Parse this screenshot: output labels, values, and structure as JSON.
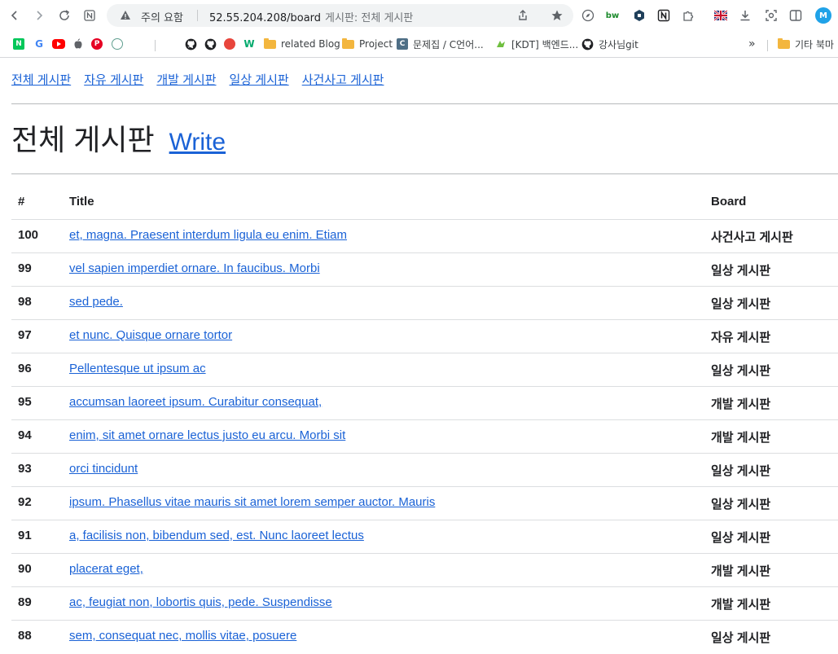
{
  "browser": {
    "security_text": "주의 요함",
    "url": "52.55.204.208/board",
    "page_title": "게시판: 전체 게시판",
    "profile_initial": "M",
    "nav_icons": [
      "back-icon",
      "forward-icon",
      "reload-icon",
      "notion-page-icon"
    ],
    "extensions": [
      "compass-icon",
      "bw-extension-icon",
      "hex-extension-icon",
      "notion-icon",
      "puzzle-icon",
      "uk-flag-icon",
      "download-icon",
      "screenshot-icon",
      "sidepanel-icon"
    ],
    "extension_labels": {
      "bw": "bw"
    }
  },
  "bookmarks": [
    {
      "label": "related Blog",
      "type": "folder"
    },
    {
      "label": "Project",
      "type": "folder"
    },
    {
      "label": "문제집 / C언어...",
      "type": "site"
    },
    {
      "label": "[KDT] 백엔드...",
      "type": "site"
    },
    {
      "label": "강사님git",
      "type": "github"
    },
    {
      "label": "기타 북마",
      "type": "folder"
    }
  ],
  "bookmarks_overflow": "»",
  "nav": {
    "links": [
      "전체 게시판",
      "자유 게시판",
      "개발 게시판",
      "일상 게시판",
      "사건사고 게시판"
    ]
  },
  "heading": {
    "title": "전체 게시판",
    "write_link": "Write"
  },
  "table": {
    "headers": {
      "num": "#",
      "title": "Title",
      "board": "Board"
    },
    "rows": [
      {
        "num": "100",
        "title": "et, magna. Praesent interdum ligula eu enim. Etiam",
        "board": "사건사고 게시판"
      },
      {
        "num": "99",
        "title": "vel sapien imperdiet ornare. In faucibus. Morbi",
        "board": "일상 게시판"
      },
      {
        "num": "98",
        "title": "sed pede.",
        "board": "일상 게시판"
      },
      {
        "num": "97",
        "title": "et nunc. Quisque ornare tortor",
        "board": "자유 게시판"
      },
      {
        "num": "96",
        "title": "Pellentesque ut ipsum ac",
        "board": "일상 게시판"
      },
      {
        "num": "95",
        "title": "accumsan laoreet ipsum. Curabitur consequat,",
        "board": "개발 게시판"
      },
      {
        "num": "94",
        "title": "enim, sit amet ornare lectus justo eu arcu. Morbi sit",
        "board": "개발 게시판"
      },
      {
        "num": "93",
        "title": "orci tincidunt",
        "board": "일상 게시판"
      },
      {
        "num": "92",
        "title": "ipsum. Phasellus vitae mauris sit amet lorem semper auctor. Mauris",
        "board": "일상 게시판"
      },
      {
        "num": "91",
        "title": "a, facilisis non, bibendum sed, est. Nunc laoreet lectus",
        "board": "일상 게시판"
      },
      {
        "num": "90",
        "title": "placerat eget,",
        "board": "개발 게시판"
      },
      {
        "num": "89",
        "title": "ac, feugiat non, lobortis quis, pede. Suspendisse",
        "board": "개발 게시판"
      },
      {
        "num": "88",
        "title": "sem, consequat nec, mollis vitae, posuere",
        "board": "일상 게시판"
      }
    ]
  }
}
